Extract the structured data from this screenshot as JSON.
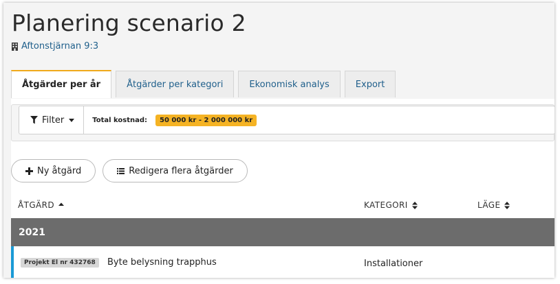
{
  "page": {
    "title": "Planering scenario 2",
    "property": {
      "icon": "building-icon",
      "label": "Aftonstjärnan 9:3"
    }
  },
  "tabs": [
    {
      "label": "Åtgärder per år",
      "active": true
    },
    {
      "label": "Åtgärder per kategori",
      "active": false
    },
    {
      "label": "Ekonomisk analys",
      "active": false
    },
    {
      "label": "Export",
      "active": false
    }
  ],
  "filter": {
    "button_label": "Filter",
    "icon": "funnel-icon",
    "cost_label": "Total kostnad:",
    "cost_value": "50 000 kr - 2 000 000 kr",
    "cost_badge_color": "#f5b324"
  },
  "actions": {
    "new_label": "Ny åtgärd",
    "edit_many_label": "Redigera flera åtgärder"
  },
  "table": {
    "columns": [
      {
        "label": "ÅTGÄRD",
        "sort": "ascending"
      },
      {
        "label": "KATEGORI",
        "sort": "unsorted"
      },
      {
        "label": "LÄGE",
        "sort": "unsorted"
      }
    ],
    "groups": [
      {
        "year": "2021",
        "rows": [
          {
            "badge": "Projekt El nr 432768",
            "name": "Byte belysning trapphus",
            "category": "Installationer"
          }
        ]
      }
    ]
  },
  "colors": {
    "accent_tab": "#f0a91a",
    "link": "#1f5f8b",
    "group_header": "#6c6c6c",
    "row_marker": "#1a9ad6"
  }
}
